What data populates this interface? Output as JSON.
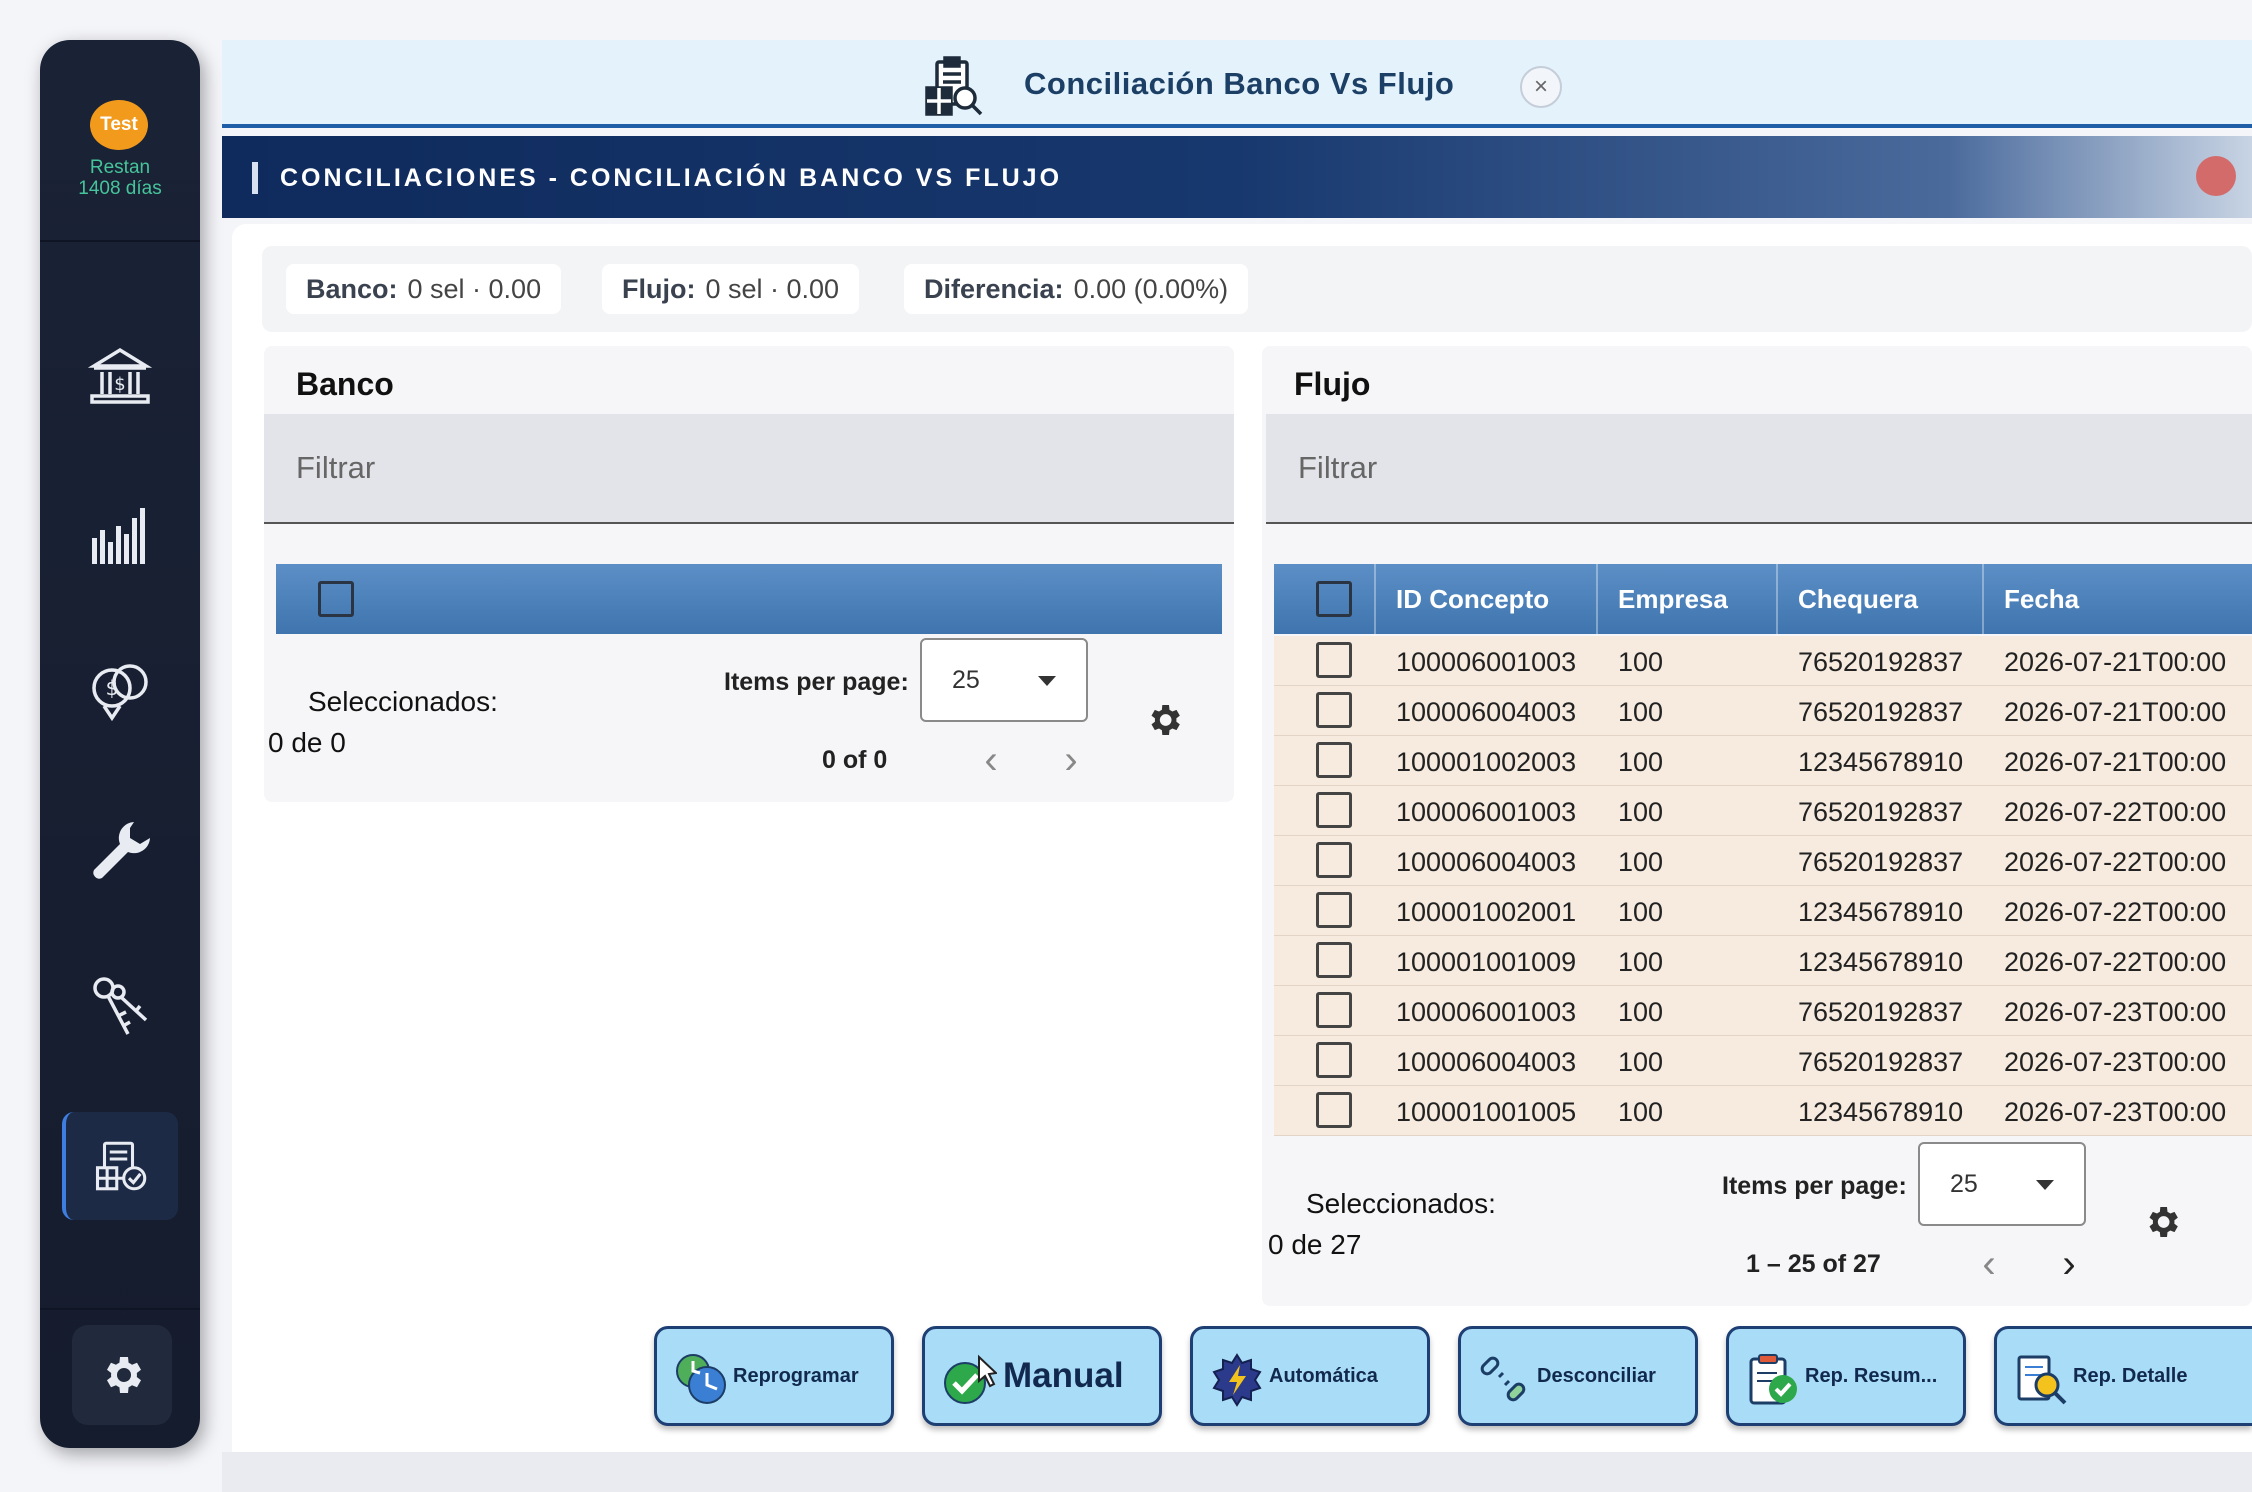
{
  "sidebar": {
    "badge": "Test",
    "remaining_line1": "Restan",
    "remaining_line2": "1408 días",
    "items": [
      {
        "name": "bank-icon"
      },
      {
        "name": "bar-chart-icon"
      },
      {
        "name": "money-transfer-icon"
      },
      {
        "name": "wrench-icon"
      },
      {
        "name": "keys-icon"
      },
      {
        "name": "reconciliation-icon"
      }
    ],
    "settings_icon": "gear-icon"
  },
  "tab": {
    "title": "Conciliación Banco Vs Flujo",
    "close": "×"
  },
  "banner": {
    "title": "CONCILIACIONES - CONCILIACIÓN BANCO VS FLUJO"
  },
  "summary": {
    "banco_label": "Banco:",
    "banco_value": "0 sel · 0.00",
    "flujo_label": "Flujo:",
    "flujo_value": "0 sel · 0.00",
    "diferencia_label": "Diferencia:",
    "diferencia_value": "0.00 (0.00%)"
  },
  "banco": {
    "title": "Banco",
    "filter_placeholder": "Filtrar",
    "selected_label": "Seleccionados:",
    "selected_count": "0 de 0",
    "items_per_page_label": "Items per page:",
    "items_per_page": "25",
    "range": "0 of 0"
  },
  "flujo": {
    "title": "Flujo",
    "filter_placeholder": "Filtrar",
    "columns": [
      "ID Concepto",
      "Empresa",
      "Chequera",
      "Fecha"
    ],
    "rows": [
      [
        "100006001003",
        "100",
        "76520192837",
        "2026-07-21T00:00"
      ],
      [
        "100006004003",
        "100",
        "76520192837",
        "2026-07-21T00:00"
      ],
      [
        "100001002003",
        "100",
        "12345678910",
        "2026-07-21T00:00"
      ],
      [
        "100006001003",
        "100",
        "76520192837",
        "2026-07-22T00:00"
      ],
      [
        "100006004003",
        "100",
        "76520192837",
        "2026-07-22T00:00"
      ],
      [
        "100001002001",
        "100",
        "12345678910",
        "2026-07-22T00:00"
      ],
      [
        "100001001009",
        "100",
        "12345678910",
        "2026-07-22T00:00"
      ],
      [
        "100006001003",
        "100",
        "76520192837",
        "2026-07-23T00:00"
      ],
      [
        "100006004003",
        "100",
        "76520192837",
        "2026-07-23T00:00"
      ],
      [
        "100001001005",
        "100",
        "12345678910",
        "2026-07-23T00:00"
      ]
    ],
    "selected_label": "Seleccionados:",
    "selected_count": "0 de 27",
    "items_per_page_label": "Items per page:",
    "items_per_page": "25",
    "range": "1 – 25 of 27"
  },
  "actions": [
    {
      "label": "Reprogramar",
      "icon": "clock-icon"
    },
    {
      "label": "Manual",
      "icon": "check-icon"
    },
    {
      "label": "Automática",
      "icon": "lightning-gear-icon"
    },
    {
      "label": "Desconciliar",
      "icon": "unlink-icon"
    },
    {
      "label": "Rep. Resum...",
      "icon": "clipboard-check-icon"
    },
    {
      "label": "Rep. Detalle",
      "icon": "document-search-icon"
    }
  ],
  "colors": {
    "sidebar_bg": "#1a2236",
    "badge": "#f29a1c",
    "remaining_text": "#46c49a",
    "banner_start": "#0f2a5c",
    "grid_header": "#4a7fb8",
    "row_bg": "#f7ebe0",
    "action_bg": "#a9dcf6",
    "action_border": "#1e3f73"
  }
}
